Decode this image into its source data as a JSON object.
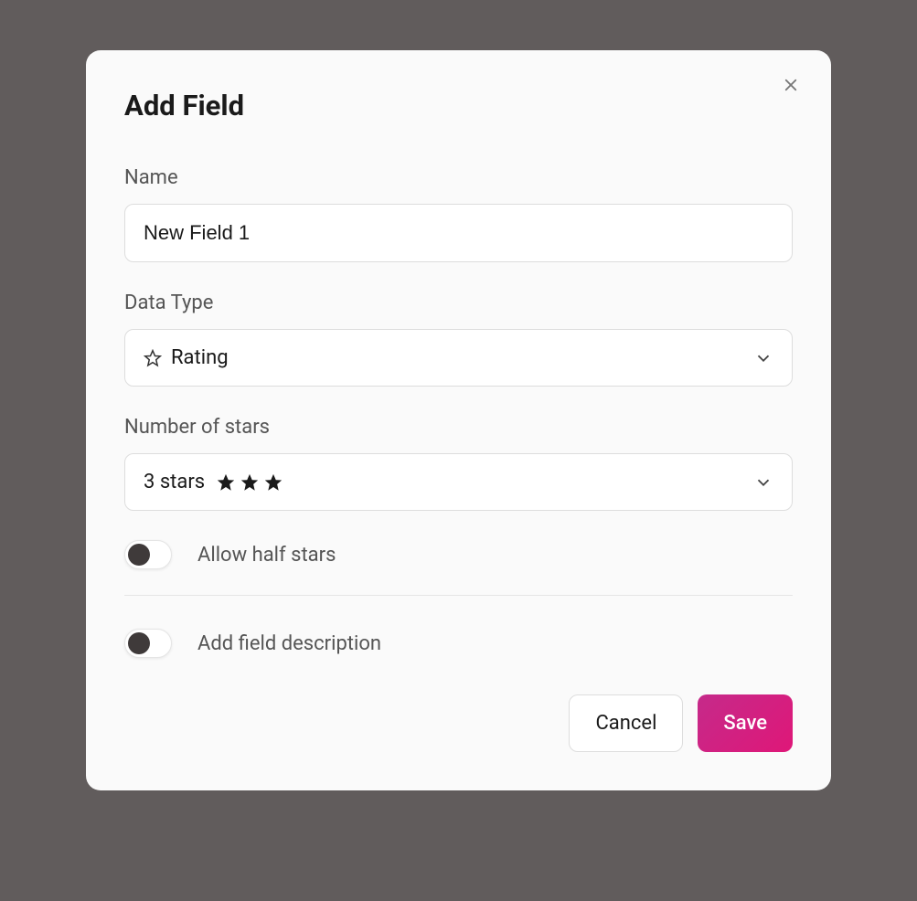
{
  "modal": {
    "title": "Add Field",
    "nameLabel": "Name",
    "nameValue": "New Field 1",
    "dataTypeLabel": "Data Type",
    "dataTypeValue": "Rating",
    "starsLabel": "Number of stars",
    "starsValue": "3 stars",
    "allowHalfStarsLabel": "Allow half stars",
    "addDescriptionLabel": "Add field description",
    "cancelButton": "Cancel",
    "saveButton": "Save"
  }
}
